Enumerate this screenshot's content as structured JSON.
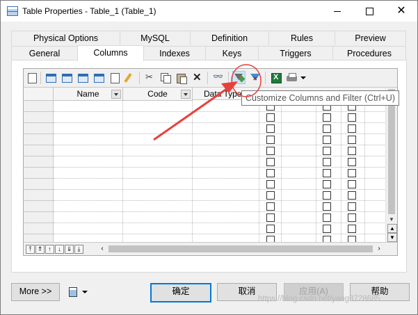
{
  "window": {
    "title": "Table Properties - Table_1 (Table_1)"
  },
  "tabs": {
    "row1": [
      "Physical Options",
      "MySQL",
      "Definition",
      "Rules",
      "Preview"
    ],
    "row2": [
      "General",
      "Columns",
      "Indexes",
      "Keys",
      "Triggers",
      "Procedures"
    ],
    "active": "Columns"
  },
  "grid": {
    "columns": [
      "Name",
      "Code",
      "Data Type"
    ],
    "visible_rows": 14,
    "rows": []
  },
  "tooltip": {
    "text": "Customize Columns and Filter (Ctrl+U)"
  },
  "buttons": {
    "more": "More >>",
    "ok": "确定",
    "cancel": "取消",
    "apply": "应用(A)",
    "help": "帮助"
  },
  "watermark": "https://blog.csdn.net/yang3728685",
  "annotation": {
    "color": "#e8403a"
  }
}
